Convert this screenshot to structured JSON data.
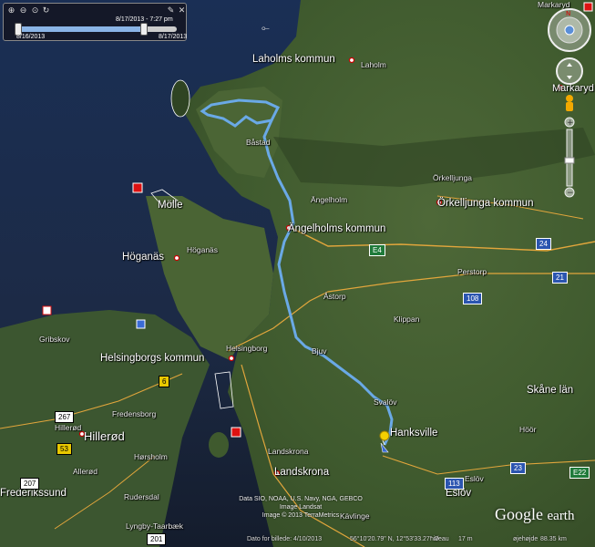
{
  "time_slider": {
    "date_top": "8/17/2013 - 7:27 pm",
    "date_left": "8/16/2013",
    "date_right": "8/17/2013"
  },
  "places": {
    "laholms_kommun": "Laholms kommun",
    "laholm": "Laholm",
    "markaryd_top": "Markaryd",
    "markaryd": "Markaryd",
    "bastad": "Båstad",
    "orkelljunga": "Örkelljunga",
    "orkelljunga_kommun": "Örkelljunga kommun",
    "angelholm": "Ängelholm",
    "angelholms_kommun": "Ängelholms kommun",
    "molle": "Mölle",
    "hoganas": "Höganäs",
    "hoganas_big": "Höganäs",
    "perstorp": "Perstorp",
    "astorp": "Åstorp",
    "klippan": "Klippan",
    "gribskov": "Gribskov",
    "bjuv": "Bjuv",
    "helsingborg": "Helsingborg",
    "helsingborgs_kommun": "Helsingborgs kommun",
    "svalov": "Svalöv",
    "hanksville": "Hanksville",
    "skane_lan": "Skåne län",
    "fredensborg": "Fredensborg",
    "hillerod_big": "Hillerød",
    "hillerod_small": "Hillerød",
    "horsholm": "Hørsholm",
    "allerod": "Allerød",
    "landskrona_small": "Landskrona",
    "landskrona": "Landskrona",
    "hoor": "Höör",
    "frederikssund": "Frederikssund",
    "rudersdal": "Rudersdal",
    "kavlinge": "Kävlinge",
    "eslov_small": "Eslöv",
    "eslov": "Eslöv",
    "lyngby": "Lyngby-Taarbæk"
  },
  "roads": [
    "E4",
    "24",
    "21",
    "108",
    "6",
    "267",
    "53",
    "207",
    "201",
    "113",
    "23",
    "E22"
  ],
  "credits": {
    "line1": "Data SIO, NOAA, U.S. Navy, NGA, GEBCO",
    "line2": "Image Landsat",
    "line3": "Image © 2013 TerraMetrics"
  },
  "brand": {
    "name": "Google",
    "suffix": "earth"
  },
  "status": {
    "date": "Dato for billede: 4/10/2013",
    "coords": "56°10'20.79\" N, 12°53'33.27\" Ø",
    "elevation": "niveau",
    "elev_value": "17 m",
    "eye_label": "øjehøjde",
    "eye_value": "88.35 km"
  },
  "colors": {
    "track": "#6aa9e6",
    "water": "#13233a",
    "land": "#3f5a2c"
  }
}
